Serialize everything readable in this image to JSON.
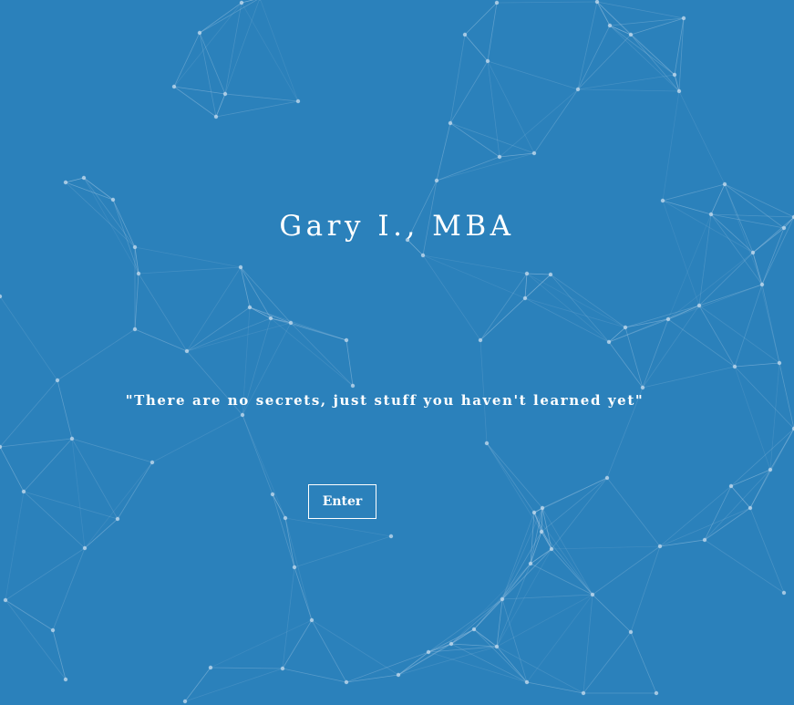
{
  "hero": {
    "title": "Gary I., MBA",
    "quote": "\"There are no secrets, just stuff you haven't learned yet\"",
    "enter_label": "Enter"
  },
  "colors": {
    "background": "#2b81bb",
    "text": "#ffffff",
    "network_lines": "#a9cbe6",
    "network_nodes": "#c7dcee"
  },
  "background": {
    "effect": "particle-network"
  }
}
